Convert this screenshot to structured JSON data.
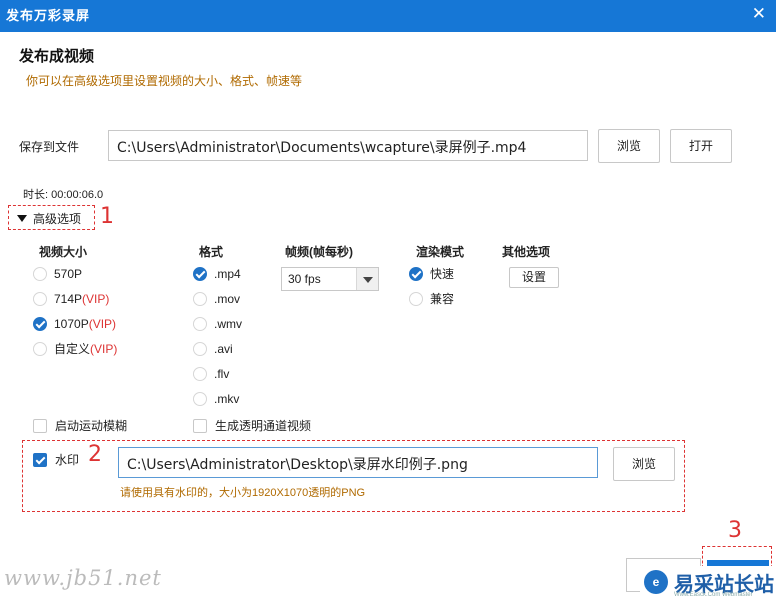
{
  "window": {
    "title": "发布万彩录屏",
    "close_icon": "close-icon"
  },
  "header": {
    "title": "发布成视频",
    "subtitle": "你可以在高级选项里设置视频的大小、格式、帧速等"
  },
  "save": {
    "label": "保存到文件",
    "path": "C:\\Users\\Administrator\\Documents\\wcapture\\录屏例子.mp4",
    "browse_label": "浏览",
    "open_label": "打开"
  },
  "duration": {
    "label": "时长:",
    "value": "00:00:06.0"
  },
  "advanced": {
    "label": "高级选项"
  },
  "annotations": {
    "one": "1",
    "two": "2",
    "three": "3"
  },
  "columns": {
    "size": "视频大小",
    "format": "格式",
    "framerate": "帧频(帧每秒)",
    "render": "渲染模式",
    "other": "其他选项"
  },
  "sizes": [
    {
      "label": "570P",
      "vip": "",
      "checked": false
    },
    {
      "label": "714P",
      "vip": "(VIP)",
      "checked": false
    },
    {
      "label": "1070P",
      "vip": "(VIP)",
      "checked": true
    },
    {
      "label": "自定义",
      "vip": "(VIP)",
      "checked": false
    }
  ],
  "formats": [
    {
      "label": ".mp4",
      "checked": true
    },
    {
      "label": ".mov",
      "checked": false
    },
    {
      "label": ".wmv",
      "checked": false
    },
    {
      "label": ".avi",
      "checked": false
    },
    {
      "label": ".flv",
      "checked": false
    },
    {
      "label": ".mkv",
      "checked": false
    }
  ],
  "framerate": {
    "value": "30 fps"
  },
  "render_modes": [
    {
      "label": "快速",
      "checked": true
    },
    {
      "label": "兼容",
      "checked": false
    }
  ],
  "other": {
    "settings_label": "设置"
  },
  "checks": {
    "motion_blur": {
      "label": "启动运动模糊",
      "checked": false
    },
    "alpha_video": {
      "label": "生成透明通道视频",
      "checked": false
    }
  },
  "watermark": {
    "label": "水印",
    "checked": true,
    "path": "C:\\Users\\Administrator\\Desktop\\录屏水印例子.png",
    "browse_label": "浏览",
    "hint": "请使用具有水印的，大小为1920X1070透明的PNG"
  },
  "footer": {
    "site_watermark": "www.jb51.net",
    "logo_text": "易采站长站",
    "logo_small": "Www.Easck.Com Webmaster"
  },
  "colors": {
    "accent": "#1677d6",
    "annotation": "#dd3333",
    "hint": "#b06a00"
  }
}
